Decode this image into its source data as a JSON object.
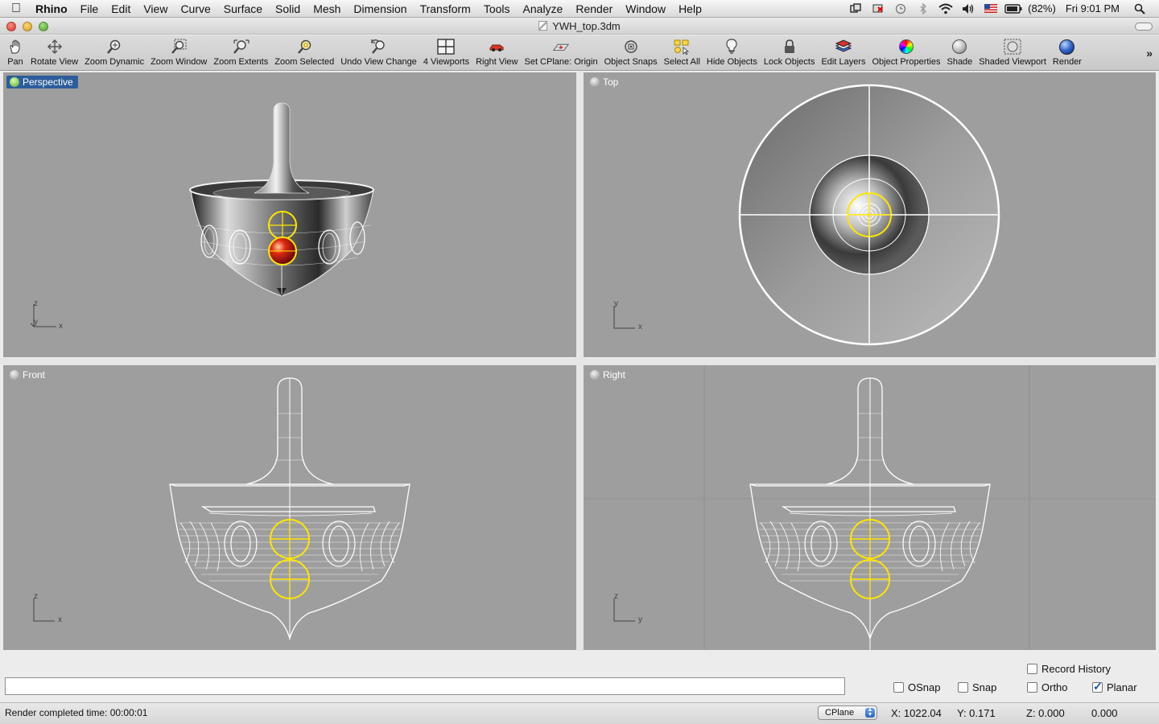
{
  "menubar": {
    "app": "Rhino",
    "items": [
      "File",
      "Edit",
      "View",
      "Curve",
      "Surface",
      "Solid",
      "Mesh",
      "Dimension",
      "Transform",
      "Tools",
      "Analyze",
      "Render",
      "Window",
      "Help"
    ],
    "battery": "(82%)",
    "clock": "Fri 9:01 PM"
  },
  "window": {
    "title": "YWH_top.3dm"
  },
  "toolbar": {
    "tools": [
      {
        "label": "Pan",
        "icon": "hand-icon"
      },
      {
        "label": "Rotate View",
        "icon": "rotate-icon"
      },
      {
        "label": "Zoom Dynamic",
        "icon": "zoom-dynamic-icon"
      },
      {
        "label": "Zoom Window",
        "icon": "zoom-window-icon"
      },
      {
        "label": "Zoom Extents",
        "icon": "zoom-extents-icon"
      },
      {
        "label": "Zoom Selected",
        "icon": "zoom-selected-icon"
      },
      {
        "label": "Undo View Change",
        "icon": "undo-view-icon"
      },
      {
        "label": "4 Viewports",
        "icon": "four-viewports-icon"
      },
      {
        "label": "Right View",
        "icon": "right-view-icon"
      },
      {
        "label": "Set CPlane: Origin",
        "icon": "cplane-origin-icon"
      },
      {
        "label": "Object Snaps",
        "icon": "object-snaps-icon"
      },
      {
        "label": "Select All",
        "icon": "select-all-icon"
      },
      {
        "label": "Hide Objects",
        "icon": "hide-objects-icon"
      },
      {
        "label": "Lock Objects",
        "icon": "lock-icon"
      },
      {
        "label": "Edit Layers",
        "icon": "layers-icon"
      },
      {
        "label": "Object Properties",
        "icon": "color-wheel-icon"
      },
      {
        "label": "Shade",
        "icon": "shade-sphere-icon"
      },
      {
        "label": "Shaded Viewport",
        "icon": "shaded-viewport-icon"
      },
      {
        "label": "Render",
        "icon": "render-sphere-icon"
      }
    ]
  },
  "viewports": {
    "perspective": {
      "label": "Perspective",
      "axis_v": "z",
      "axis_h": "x",
      "axis_d": "y"
    },
    "top": {
      "label": "Top",
      "axis_v": "y",
      "axis_h": "x"
    },
    "front": {
      "label": "Front",
      "axis_v": "z",
      "axis_h": "x"
    },
    "right": {
      "label": "Right",
      "axis_v": "z",
      "axis_h": "y"
    }
  },
  "command": {
    "value": ""
  },
  "options": {
    "record_history": {
      "label": "Record History",
      "checked": false
    },
    "osnap": {
      "label": "OSnap",
      "checked": false
    },
    "snap": {
      "label": "Snap",
      "checked": false
    },
    "ortho": {
      "label": "Ortho",
      "checked": false
    },
    "planar": {
      "label": "Planar",
      "checked": true
    }
  },
  "status": {
    "message": "Render completed time: 00:00:01",
    "cplane": "CPlane",
    "x": "X: 1022.04",
    "y": "Y: 0.171",
    "z": "Z: 0.000",
    "extra": "0.000"
  },
  "colors": {
    "viewport_bg": "#9e9e9e",
    "active_label": "#2d5d9a",
    "highlight": "#ffe600",
    "wire": "#ffffff",
    "sphere": "#d01a0a"
  }
}
